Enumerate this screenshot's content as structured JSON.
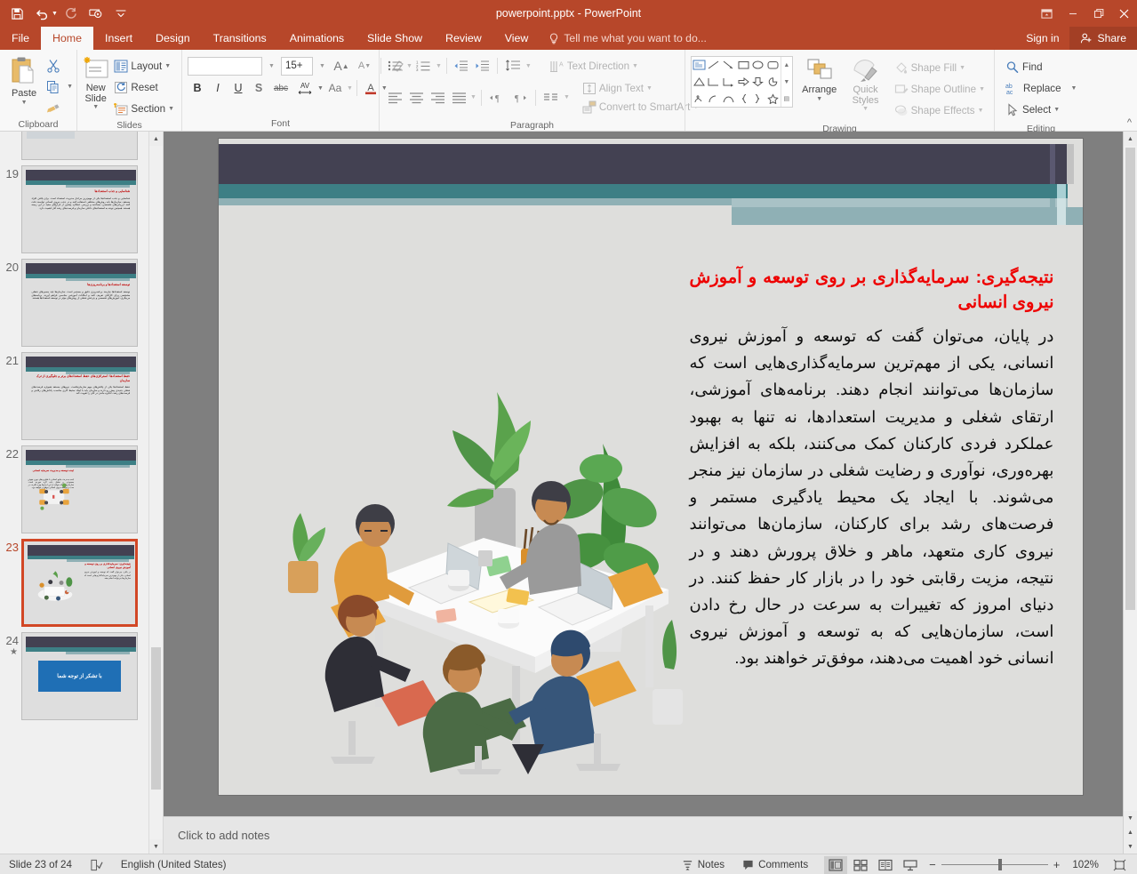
{
  "window": {
    "title": "powerpoint.pptx - PowerPoint",
    "quick_access": [
      "save-icon",
      "undo-icon",
      "redo-icon",
      "start-presentation-icon",
      "customize-qat-icon"
    ],
    "controls": [
      "ribbon-display-options-icon",
      "minimize-icon",
      "restore-icon",
      "close-icon"
    ],
    "sign_in": "Sign in",
    "share": "Share"
  },
  "tabs": [
    {
      "label": "File",
      "active": false
    },
    {
      "label": "Home",
      "active": true
    },
    {
      "label": "Insert",
      "active": false
    },
    {
      "label": "Design",
      "active": false
    },
    {
      "label": "Transitions",
      "active": false
    },
    {
      "label": "Animations",
      "active": false
    },
    {
      "label": "Slide Show",
      "active": false
    },
    {
      "label": "Review",
      "active": false
    },
    {
      "label": "View",
      "active": false
    }
  ],
  "tell_me": "Tell me what you want to do...",
  "ribbon": {
    "clipboard": {
      "label": "Clipboard",
      "paste": "Paste",
      "cut": "cut-icon",
      "copy": "copy-icon",
      "format_painter": "format-painter-icon"
    },
    "slides": {
      "label": "Slides",
      "new_slide": "New Slide",
      "layout": "Layout",
      "reset": "Reset",
      "section": "Section"
    },
    "font": {
      "label": "Font",
      "font_name": "",
      "font_name_placeholder": "",
      "font_size": "15+",
      "bold": "B",
      "italic": "I",
      "underline": "U",
      "shadow": "S",
      "strikethrough": "abc",
      "character_spacing": "AV",
      "change_case": "Aa",
      "font_color": "A",
      "increase_size": "A",
      "decrease_size": "A",
      "clear_formatting": "clear-formatting-icon"
    },
    "paragraph": {
      "label": "Paragraph",
      "text_direction": "Text Direction",
      "align_text": "Align Text",
      "convert_to_smartart": "Convert to SmartArt"
    },
    "drawing": {
      "label": "Drawing",
      "arrange": "Arrange",
      "quick_styles": "Quick Styles",
      "shape_fill": "Shape Fill",
      "shape_outline": "Shape Outline",
      "shape_effects": "Shape Effects"
    },
    "editing": {
      "label": "Editing",
      "find": "Find",
      "replace": "Replace",
      "select": "Select"
    }
  },
  "slide_panel": {
    "slides": [
      {
        "number": "19",
        "selected": false,
        "title": "شناسایی و جذب استعدادها",
        "body": "شناسایی و جذب استعدادها یکی از مهم‌ترین مراحل مدیریت استعداد است. برای یافتن افراد مستعد، سازمان‌ها باید روش‌های مختلفی استفاده کنند و در جذب نیروی انسانی توانمند دقت کنند. ارزیابی‌های تخصصی، مصاحبه و بررسی عملکرد پیشین از ابزارهای مفید در این زمینه هستند. همچنین توجه به استعدادهای داخلی سازمان و فرصت‌های رشد آنان اهمیت دارد."
      },
      {
        "number": "20",
        "selected": false,
        "title": "توسعه استعدادها و برنامه‌ریزی‌ها",
        "body": "توسعه استعدادها نیازمند برنامه‌ریزی دقیق و مستمر است. سازمان‌ها باید مسیرهای شغلی مشخصی برای کارکنان تعریف کنند و امکانات آموزشی مناسبی فراهم آورند. برنامه‌های مربیگری، آموزش‌های تخصصی و چرخش شغلی از روش‌های مؤثر در توسعه استعدادها هستند."
      },
      {
        "number": "21",
        "selected": false,
        "title": "حفظ استعدادها: استراتژی‌های حفظ استعدادهای برتر و جلوگیری از ترک سازمان",
        "body": "حفظ استعدادها یکی از چالش‌های مهم سازمان‌هاست. نیروهای مستعد همواره فرصت‌های شغلی جدیدی پیش رو دارند و سازمان باید با ایجاد محیط کاری مناسب، پاداش‌های رقابتی و فرصت‌های رشد، انگیزه ماندن در آنان را تقویت کند."
      },
      {
        "number": "22",
        "selected": false,
        "title": "آینده توسعه و مدیریت سرمایه انسانی",
        "body": "آینده مدیریت منابع انسانی با فناوری‌های نوین، هوش مصنوعی و تحلیل داده گره خورده است. سازمان‌هایی که بتوانند از این ابزارها بهره بگیرند، در جذب و توسعه نیروی انسانی موفق‌تر خواهند بود."
      },
      {
        "number": "23",
        "selected": true,
        "title": "نتیجه‌گیری: سرمایه‌گذاری بر روی توسعه و آموزش نیروی انسانی",
        "body": "در پایان، می‌توان گفت که توسعه و آموزش نیروی انسانی، یکی از مهم‌ترین سرمایه‌گذاری‌هایی است که سازمان‌ها می‌توانند انجام دهند."
      },
      {
        "number": "24",
        "selected": false,
        "has_star": true,
        "thanks": "با تشکر از توجه شما"
      }
    ]
  },
  "slide": {
    "title": "نتیجه‌گیری: سرمایه‌گذاری بر روی توسعه و آموزش نیروی انسانی",
    "body": "در پایان، می‌توان گفت که توسعه و آموزش نیروی انسانی، یکی از مهم‌ترین سرمایه‌گذاری‌هایی است که سازمان‌ها می‌توانند انجام دهند. برنامه‌های آموزشی، ارتقای شغلی و مدیریت استعدادها، نه تنها به بهبود عملکرد فردی کارکنان کمک می‌کنند، بلکه به افزایش بهره‌وری، نوآوری و رضایت شغلی در سازمان نیز منجر می‌شوند. با ایجاد یک محیط یادگیری مستمر و فرصت‌های رشد برای کارکنان، سازمان‌ها می‌توانند نیروی کاری متعهد، ماهر و خلاق پرورش دهند و در نتیجه، مزیت رقابتی خود را در بازار کار حفظ کنند. در دنیای امروز که تغییرات به سرعت در حال رخ دادن است، سازمان‌هایی که به توسعه و آموزش نیروی انسانی خود اهمیت می‌دهند، موفق‌تر خواهند بود.",
    "illustration": "team-meeting-illustration",
    "colors": {
      "header_dark": "#434152",
      "header_teal": "#3d7f85",
      "header_light": "#8fb0b5",
      "title_red": "#ee0000",
      "background": "#dededc"
    }
  },
  "notes": {
    "placeholder": "Click to add notes"
  },
  "status": {
    "slide_indicator": "Slide 23 of 24",
    "language": "English (United States)",
    "notes_button": "Notes",
    "comments_button": "Comments",
    "views": [
      "normal-view-icon",
      "slide-sorter-icon",
      "reading-view-icon",
      "slide-show-icon"
    ],
    "zoom_level": "102%",
    "zoom_out": "−",
    "zoom_in": "+",
    "fit_slide": "fit-to-window-icon"
  }
}
